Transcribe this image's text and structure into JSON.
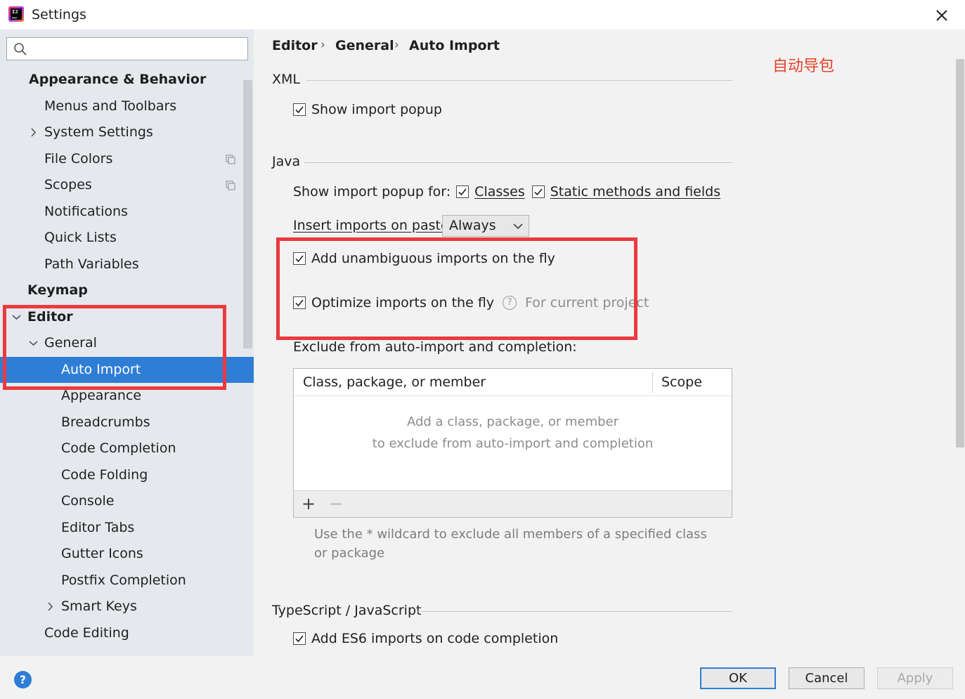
{
  "window": {
    "title": "Settings"
  },
  "search": {
    "value": "",
    "placeholder": ""
  },
  "sidebar": {
    "items": [
      {
        "label": "Appearance & Behavior"
      },
      {
        "label": "Menus and Toolbars"
      },
      {
        "label": "System Settings"
      },
      {
        "label": "File Colors"
      },
      {
        "label": "Scopes"
      },
      {
        "label": "Notifications"
      },
      {
        "label": "Quick Lists"
      },
      {
        "label": "Path Variables"
      },
      {
        "label": "Keymap"
      },
      {
        "label": "Editor"
      },
      {
        "label": "General"
      },
      {
        "label": "Auto Import"
      },
      {
        "label": "Appearance"
      },
      {
        "label": "Breadcrumbs"
      },
      {
        "label": "Code Completion"
      },
      {
        "label": "Code Folding"
      },
      {
        "label": "Console"
      },
      {
        "label": "Editor Tabs"
      },
      {
        "label": "Gutter Icons"
      },
      {
        "label": "Postfix Completion"
      },
      {
        "label": "Smart Keys"
      },
      {
        "label": "Code Editing"
      }
    ],
    "selected": "Auto Import"
  },
  "breadcrumb": [
    "Editor",
    "General",
    "Auto Import"
  ],
  "annotation": "自动导包",
  "xml": {
    "title": "XML",
    "show_import_popup": {
      "label": "Show import popup",
      "checked": true
    }
  },
  "java": {
    "title": "Java",
    "popup_for_label": "Show import popup for:",
    "classes": {
      "label": "Classes",
      "checked": true
    },
    "static_members": {
      "label": "Static methods and fields",
      "checked": true
    },
    "insert_on_paste_label": "Insert imports on paste:",
    "insert_on_paste_value": "Always",
    "add_unambiguous": {
      "label": "Add unambiguous imports on the fly",
      "checked": true
    },
    "optimize_imports": {
      "label": "Optimize imports on the fly",
      "checked": true,
      "scope_note": "For current project"
    },
    "help_glyph": "?",
    "exclude_label": "Exclude from auto-import and completion:",
    "table": {
      "columns": [
        "Class, package, or member",
        "Scope"
      ],
      "empty_line1": "Add a class, package, or member",
      "empty_line2": "to exclude from auto-import and completion"
    },
    "toolbar": {
      "add": "+",
      "remove": "−"
    },
    "hint": "Use the * wildcard to exclude all members of a specified class or package"
  },
  "ts": {
    "title": "TypeScript / JavaScript",
    "add_es6": {
      "label": "Add ES6 imports on code completion",
      "checked": true
    }
  },
  "buttons": {
    "help": "?",
    "ok": "OK",
    "cancel": "Cancel",
    "apply": "Apply"
  },
  "colors": {
    "accent": "#2f7ed6",
    "highlight_box": "#ea3a3f",
    "annotation": "#e8412b"
  }
}
